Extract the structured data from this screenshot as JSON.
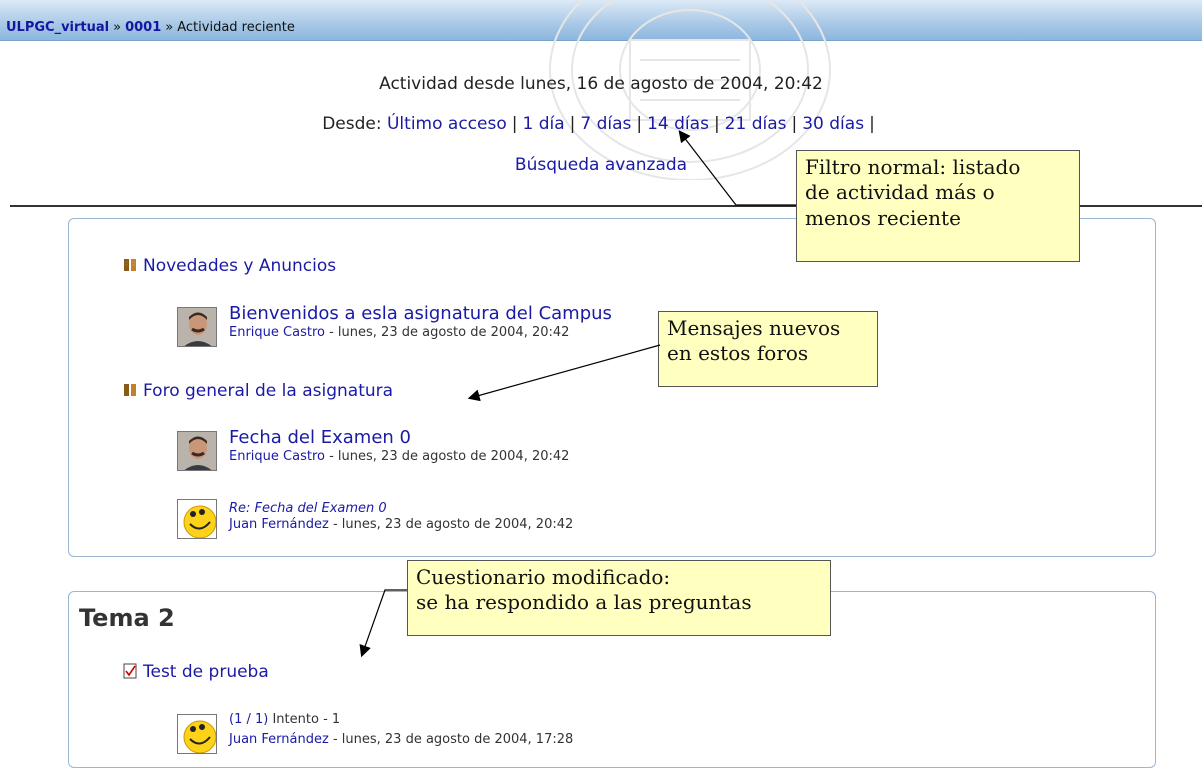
{
  "breadcrumb": {
    "site": "ULPGC_virtual",
    "course": "0001",
    "current": "Actividad reciente",
    "separator": "»"
  },
  "header": {
    "since_text": "Actividad desde lunes, 16 de agosto de 2004, 20:42",
    "desde_label": "Desde:",
    "filters": [
      "Último acceso",
      "1 día",
      "7 días",
      "14 días",
      "21 días",
      "30 días"
    ],
    "advanced_search": "Búsqueda avanzada"
  },
  "forums": [
    {
      "name": "Novedades y Anuncios",
      "posts": [
        {
          "title": "Bienvenidos a esla asignatura del Campus",
          "author": "Enrique Castro",
          "date": " - lunes, 23 de agosto de 2004, 20:42"
        }
      ]
    },
    {
      "name": "Foro general de la asignatura",
      "posts": [
        {
          "title": "Fecha del Examen 0",
          "author": "Enrique Castro",
          "date": " - lunes, 23 de agosto de 2004, 20:42"
        },
        {
          "title": "Re: Fecha del Examen 0",
          "author": "Juan Fernández",
          "date": " - lunes, 23 de agosto de 2004, 20:42"
        }
      ]
    }
  ],
  "section2": {
    "title": "Tema 2",
    "quiz": {
      "name": "Test de prueba",
      "attempt_link": "(1 / 1)",
      "attempt_text": " Intento - 1",
      "author": "Juan Fernández",
      "date": " - lunes, 23 de agosto de 2004, 17:28"
    }
  },
  "callouts": {
    "filter": [
      "Filtro normal: listado",
      "de actividad más o",
      "menos reciente"
    ],
    "messages": [
      "Mensajes nuevos",
      "en estos foros"
    ],
    "quiz": [
      "Cuestionario modificado:",
      "se ha respondido a las preguntas"
    ]
  },
  "colors": {
    "link": "#1a1aa6",
    "callout_bg": "#ffffc0",
    "navbar": "#a8c8e6",
    "box_border": "#9bb6d2"
  }
}
